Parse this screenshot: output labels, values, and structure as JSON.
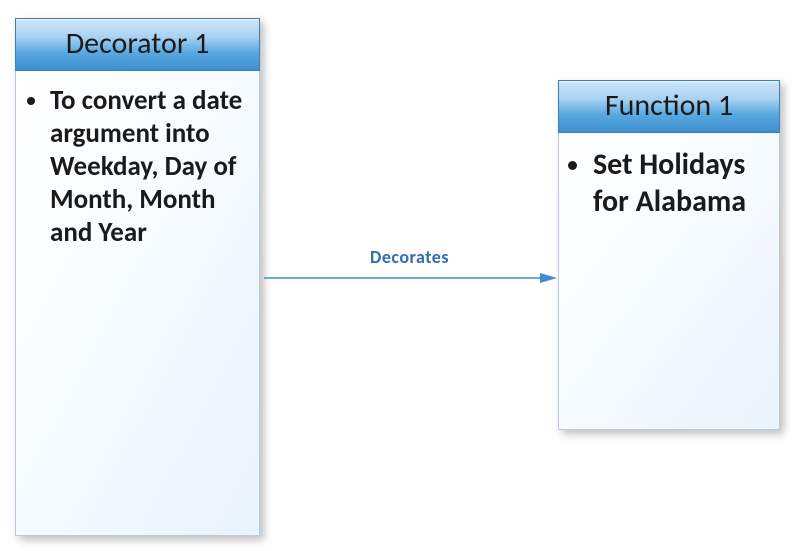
{
  "left_box": {
    "title": "Decorator 1",
    "bullet": "To convert a date argument into Weekday, Day of Month, Month and Year"
  },
  "right_box": {
    "title": "Function 1",
    "bullet": "Set Holidays for Alabama"
  },
  "connector": {
    "label": "Decorates"
  },
  "colors": {
    "header_gradient_top": "#cfe6f7",
    "header_gradient_bottom": "#3d8fcf",
    "body_gradient_top": "#ffffff",
    "body_gradient_bottom": "#e9f3fb",
    "connector_color": "#3d8fcf",
    "connector_label_color": "#2d6fb3"
  }
}
